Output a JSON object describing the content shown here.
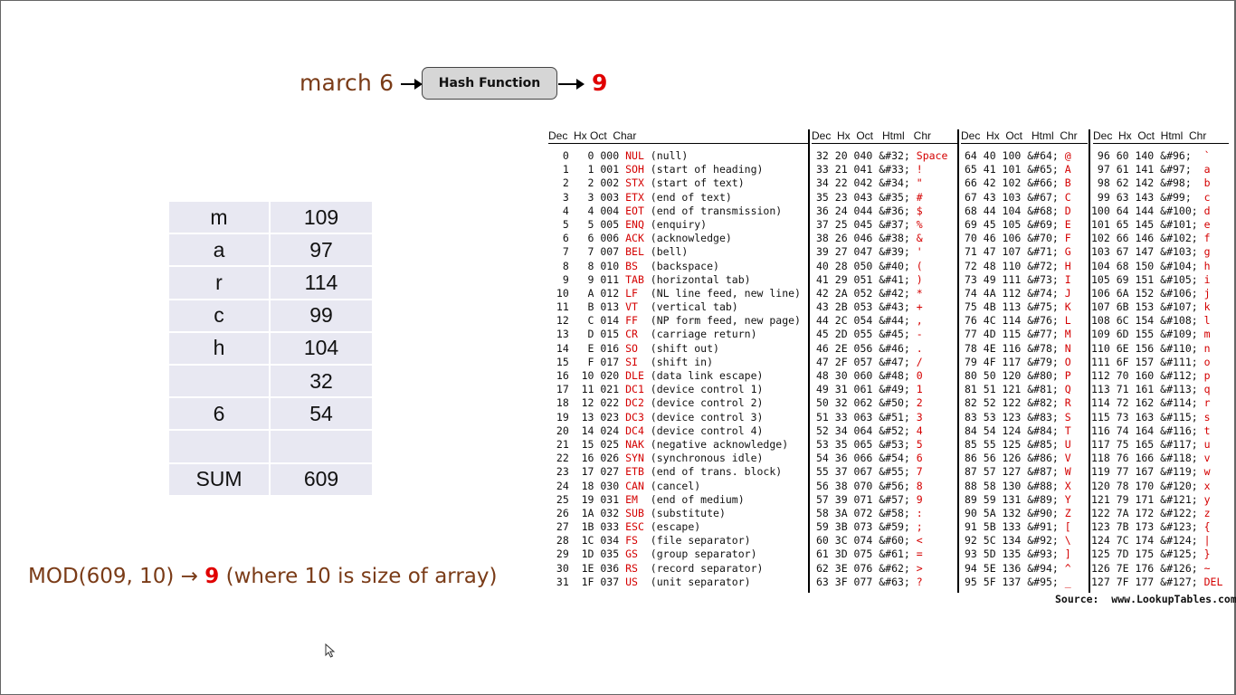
{
  "hash": {
    "input": "march 6",
    "function_label": "Hash Function",
    "output": "9"
  },
  "char_table": [
    {
      "char": "m",
      "code": "109"
    },
    {
      "char": "a",
      "code": "97"
    },
    {
      "char": "r",
      "code": "114"
    },
    {
      "char": "c",
      "code": "99"
    },
    {
      "char": "h",
      "code": "104"
    },
    {
      "char": "",
      "code": "32"
    },
    {
      "char": "6",
      "code": "54"
    },
    {
      "char": "",
      "code": ""
    },
    {
      "char": "SUM",
      "code": "609"
    }
  ],
  "mod": {
    "prefix": "MOD(609, 10) → ",
    "result": "9",
    "suffix": "  (where 10 is size of array)"
  },
  "ascii": {
    "headers": [
      "Dec  Hx Oct  Char",
      "Dec  Hx  Oct   Html   Chr",
      "Dec  Hx  Oct   Html  Chr",
      "Dec  Hx  Oct  Html  Chr"
    ],
    "col1": [
      [
        "  0   0 000 ",
        "NUL",
        " (null)"
      ],
      [
        "  1   1 001 ",
        "SOH",
        " (start of heading)"
      ],
      [
        "  2   2 002 ",
        "STX",
        " (start of text)"
      ],
      [
        "  3   3 003 ",
        "ETX",
        " (end of text)"
      ],
      [
        "  4   4 004 ",
        "EOT",
        " (end of transmission)"
      ],
      [
        "  5   5 005 ",
        "ENQ",
        " (enquiry)"
      ],
      [
        "  6   6 006 ",
        "ACK",
        " (acknowledge)"
      ],
      [
        "  7   7 007 ",
        "BEL",
        " (bell)"
      ],
      [
        "  8   8 010 ",
        "BS ",
        " (backspace)"
      ],
      [
        "  9   9 011 ",
        "TAB",
        " (horizontal tab)"
      ],
      [
        " 10   A 012 ",
        "LF ",
        " (NL line feed, new line)"
      ],
      [
        " 11   B 013 ",
        "VT ",
        " (vertical tab)"
      ],
      [
        " 12   C 014 ",
        "FF ",
        " (NP form feed, new page)"
      ],
      [
        " 13   D 015 ",
        "CR ",
        " (carriage return)"
      ],
      [
        " 14   E 016 ",
        "SO ",
        " (shift out)"
      ],
      [
        " 15   F 017 ",
        "SI ",
        " (shift in)"
      ],
      [
        " 16  10 020 ",
        "DLE",
        " (data link escape)"
      ],
      [
        " 17  11 021 ",
        "DC1",
        " (device control 1)"
      ],
      [
        " 18  12 022 ",
        "DC2",
        " (device control 2)"
      ],
      [
        " 19  13 023 ",
        "DC3",
        " (device control 3)"
      ],
      [
        " 20  14 024 ",
        "DC4",
        " (device control 4)"
      ],
      [
        " 21  15 025 ",
        "NAK",
        " (negative acknowledge)"
      ],
      [
        " 22  16 026 ",
        "SYN",
        " (synchronous idle)"
      ],
      [
        " 23  17 027 ",
        "ETB",
        " (end of trans. block)"
      ],
      [
        " 24  18 030 ",
        "CAN",
        " (cancel)"
      ],
      [
        " 25  19 031 ",
        "EM ",
        " (end of medium)"
      ],
      [
        " 26  1A 032 ",
        "SUB",
        " (substitute)"
      ],
      [
        " 27  1B 033 ",
        "ESC",
        " (escape)"
      ],
      [
        " 28  1C 034 ",
        "FS ",
        " (file separator)"
      ],
      [
        " 29  1D 035 ",
        "GS ",
        " (group separator)"
      ],
      [
        " 30  1E 036 ",
        "RS ",
        " (record separator)"
      ],
      [
        " 31  1F 037 ",
        "US ",
        " (unit separator)"
      ]
    ],
    "col2": [
      [
        "32 20 040 &#32; ",
        "Space"
      ],
      [
        "33 21 041 &#33; ",
        "!"
      ],
      [
        "34 22 042 &#34; ",
        "\""
      ],
      [
        "35 23 043 &#35; ",
        "#"
      ],
      [
        "36 24 044 &#36; ",
        "$"
      ],
      [
        "37 25 045 &#37; ",
        "%"
      ],
      [
        "38 26 046 &#38; ",
        "&"
      ],
      [
        "39 27 047 &#39; ",
        "'"
      ],
      [
        "40 28 050 &#40; ",
        "("
      ],
      [
        "41 29 051 &#41; ",
        ")"
      ],
      [
        "42 2A 052 &#42; ",
        "*"
      ],
      [
        "43 2B 053 &#43; ",
        "+"
      ],
      [
        "44 2C 054 &#44; ",
        ","
      ],
      [
        "45 2D 055 &#45; ",
        "-"
      ],
      [
        "46 2E 056 &#46; ",
        "."
      ],
      [
        "47 2F 057 &#47; ",
        "/"
      ],
      [
        "48 30 060 &#48; ",
        "0"
      ],
      [
        "49 31 061 &#49; ",
        "1"
      ],
      [
        "50 32 062 &#50; ",
        "2"
      ],
      [
        "51 33 063 &#51; ",
        "3"
      ],
      [
        "52 34 064 &#52; ",
        "4"
      ],
      [
        "53 35 065 &#53; ",
        "5"
      ],
      [
        "54 36 066 &#54; ",
        "6"
      ],
      [
        "55 37 067 &#55; ",
        "7"
      ],
      [
        "56 38 070 &#56; ",
        "8"
      ],
      [
        "57 39 071 &#57; ",
        "9"
      ],
      [
        "58 3A 072 &#58; ",
        ":"
      ],
      [
        "59 3B 073 &#59; ",
        ";"
      ],
      [
        "60 3C 074 &#60; ",
        "<"
      ],
      [
        "61 3D 075 &#61; ",
        "="
      ],
      [
        "62 3E 076 &#62; ",
        ">"
      ],
      [
        "63 3F 077 &#63; ",
        "?"
      ]
    ],
    "col3": [
      [
        "64 40 100 &#64; ",
        "@"
      ],
      [
        "65 41 101 &#65; ",
        "A"
      ],
      [
        "66 42 102 &#66; ",
        "B"
      ],
      [
        "67 43 103 &#67; ",
        "C"
      ],
      [
        "68 44 104 &#68; ",
        "D"
      ],
      [
        "69 45 105 &#69; ",
        "E"
      ],
      [
        "70 46 106 &#70; ",
        "F"
      ],
      [
        "71 47 107 &#71; ",
        "G"
      ],
      [
        "72 48 110 &#72; ",
        "H"
      ],
      [
        "73 49 111 &#73; ",
        "I"
      ],
      [
        "74 4A 112 &#74; ",
        "J"
      ],
      [
        "75 4B 113 &#75; ",
        "K"
      ],
      [
        "76 4C 114 &#76; ",
        "L"
      ],
      [
        "77 4D 115 &#77; ",
        "M"
      ],
      [
        "78 4E 116 &#78; ",
        "N"
      ],
      [
        "79 4F 117 &#79; ",
        "O"
      ],
      [
        "80 50 120 &#80; ",
        "P"
      ],
      [
        "81 51 121 &#81; ",
        "Q"
      ],
      [
        "82 52 122 &#82; ",
        "R"
      ],
      [
        "83 53 123 &#83; ",
        "S"
      ],
      [
        "84 54 124 &#84; ",
        "T"
      ],
      [
        "85 55 125 &#85; ",
        "U"
      ],
      [
        "86 56 126 &#86; ",
        "V"
      ],
      [
        "87 57 127 &#87; ",
        "W"
      ],
      [
        "88 58 130 &#88; ",
        "X"
      ],
      [
        "89 59 131 &#89; ",
        "Y"
      ],
      [
        "90 5A 132 &#90; ",
        "Z"
      ],
      [
        "91 5B 133 &#91; ",
        "["
      ],
      [
        "92 5C 134 &#92; ",
        "\\"
      ],
      [
        "93 5D 135 &#93; ",
        "]"
      ],
      [
        "94 5E 136 &#94; ",
        "^"
      ],
      [
        "95 5F 137 &#95; ",
        "_"
      ]
    ],
    "col4": [
      [
        " 96 60 140 &#96;  ",
        "`"
      ],
      [
        " 97 61 141 &#97;  ",
        "a"
      ],
      [
        " 98 62 142 &#98;  ",
        "b"
      ],
      [
        " 99 63 143 &#99;  ",
        "c"
      ],
      [
        "100 64 144 &#100; ",
        "d"
      ],
      [
        "101 65 145 &#101; ",
        "e"
      ],
      [
        "102 66 146 &#102; ",
        "f"
      ],
      [
        "103 67 147 &#103; ",
        "g"
      ],
      [
        "104 68 150 &#104; ",
        "h"
      ],
      [
        "105 69 151 &#105; ",
        "i"
      ],
      [
        "106 6A 152 &#106; ",
        "j"
      ],
      [
        "107 6B 153 &#107; ",
        "k"
      ],
      [
        "108 6C 154 &#108; ",
        "l"
      ],
      [
        "109 6D 155 &#109; ",
        "m"
      ],
      [
        "110 6E 156 &#110; ",
        "n"
      ],
      [
        "111 6F 157 &#111; ",
        "o"
      ],
      [
        "112 70 160 &#112; ",
        "p"
      ],
      [
        "113 71 161 &#113; ",
        "q"
      ],
      [
        "114 72 162 &#114; ",
        "r"
      ],
      [
        "115 73 163 &#115; ",
        "s"
      ],
      [
        "116 74 164 &#116; ",
        "t"
      ],
      [
        "117 75 165 &#117; ",
        "u"
      ],
      [
        "118 76 166 &#118; ",
        "v"
      ],
      [
        "119 77 167 &#119; ",
        "w"
      ],
      [
        "120 78 170 &#120; ",
        "x"
      ],
      [
        "121 79 171 &#121; ",
        "y"
      ],
      [
        "122 7A 172 &#122; ",
        "z"
      ],
      [
        "123 7B 173 &#123; ",
        "{"
      ],
      [
        "124 7C 174 &#124; ",
        "|"
      ],
      [
        "125 7D 175 &#125; ",
        "}"
      ],
      [
        "126 7E 176 &#126; ",
        "~"
      ],
      [
        "127 7F 177 &#127; ",
        "DEL"
      ]
    ],
    "source": "Source:  www.LookupTables.com"
  }
}
